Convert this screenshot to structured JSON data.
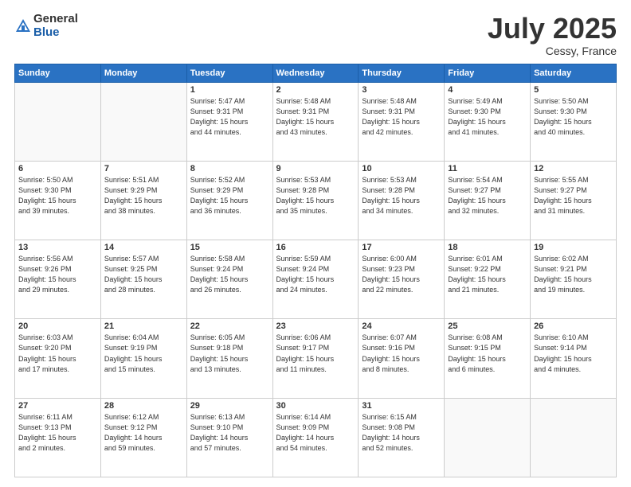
{
  "logo": {
    "general": "General",
    "blue": "Blue"
  },
  "title": "July 2025",
  "location": "Cessy, France",
  "days_header": [
    "Sunday",
    "Monday",
    "Tuesday",
    "Wednesday",
    "Thursday",
    "Friday",
    "Saturday"
  ],
  "weeks": [
    [
      {
        "day": "",
        "text": ""
      },
      {
        "day": "",
        "text": ""
      },
      {
        "day": "1",
        "text": "Sunrise: 5:47 AM\nSunset: 9:31 PM\nDaylight: 15 hours\nand 44 minutes."
      },
      {
        "day": "2",
        "text": "Sunrise: 5:48 AM\nSunset: 9:31 PM\nDaylight: 15 hours\nand 43 minutes."
      },
      {
        "day": "3",
        "text": "Sunrise: 5:48 AM\nSunset: 9:31 PM\nDaylight: 15 hours\nand 42 minutes."
      },
      {
        "day": "4",
        "text": "Sunrise: 5:49 AM\nSunset: 9:30 PM\nDaylight: 15 hours\nand 41 minutes."
      },
      {
        "day": "5",
        "text": "Sunrise: 5:50 AM\nSunset: 9:30 PM\nDaylight: 15 hours\nand 40 minutes."
      }
    ],
    [
      {
        "day": "6",
        "text": "Sunrise: 5:50 AM\nSunset: 9:30 PM\nDaylight: 15 hours\nand 39 minutes."
      },
      {
        "day": "7",
        "text": "Sunrise: 5:51 AM\nSunset: 9:29 PM\nDaylight: 15 hours\nand 38 minutes."
      },
      {
        "day": "8",
        "text": "Sunrise: 5:52 AM\nSunset: 9:29 PM\nDaylight: 15 hours\nand 36 minutes."
      },
      {
        "day": "9",
        "text": "Sunrise: 5:53 AM\nSunset: 9:28 PM\nDaylight: 15 hours\nand 35 minutes."
      },
      {
        "day": "10",
        "text": "Sunrise: 5:53 AM\nSunset: 9:28 PM\nDaylight: 15 hours\nand 34 minutes."
      },
      {
        "day": "11",
        "text": "Sunrise: 5:54 AM\nSunset: 9:27 PM\nDaylight: 15 hours\nand 32 minutes."
      },
      {
        "day": "12",
        "text": "Sunrise: 5:55 AM\nSunset: 9:27 PM\nDaylight: 15 hours\nand 31 minutes."
      }
    ],
    [
      {
        "day": "13",
        "text": "Sunrise: 5:56 AM\nSunset: 9:26 PM\nDaylight: 15 hours\nand 29 minutes."
      },
      {
        "day": "14",
        "text": "Sunrise: 5:57 AM\nSunset: 9:25 PM\nDaylight: 15 hours\nand 28 minutes."
      },
      {
        "day": "15",
        "text": "Sunrise: 5:58 AM\nSunset: 9:24 PM\nDaylight: 15 hours\nand 26 minutes."
      },
      {
        "day": "16",
        "text": "Sunrise: 5:59 AM\nSunset: 9:24 PM\nDaylight: 15 hours\nand 24 minutes."
      },
      {
        "day": "17",
        "text": "Sunrise: 6:00 AM\nSunset: 9:23 PM\nDaylight: 15 hours\nand 22 minutes."
      },
      {
        "day": "18",
        "text": "Sunrise: 6:01 AM\nSunset: 9:22 PM\nDaylight: 15 hours\nand 21 minutes."
      },
      {
        "day": "19",
        "text": "Sunrise: 6:02 AM\nSunset: 9:21 PM\nDaylight: 15 hours\nand 19 minutes."
      }
    ],
    [
      {
        "day": "20",
        "text": "Sunrise: 6:03 AM\nSunset: 9:20 PM\nDaylight: 15 hours\nand 17 minutes."
      },
      {
        "day": "21",
        "text": "Sunrise: 6:04 AM\nSunset: 9:19 PM\nDaylight: 15 hours\nand 15 minutes."
      },
      {
        "day": "22",
        "text": "Sunrise: 6:05 AM\nSunset: 9:18 PM\nDaylight: 15 hours\nand 13 minutes."
      },
      {
        "day": "23",
        "text": "Sunrise: 6:06 AM\nSunset: 9:17 PM\nDaylight: 15 hours\nand 11 minutes."
      },
      {
        "day": "24",
        "text": "Sunrise: 6:07 AM\nSunset: 9:16 PM\nDaylight: 15 hours\nand 8 minutes."
      },
      {
        "day": "25",
        "text": "Sunrise: 6:08 AM\nSunset: 9:15 PM\nDaylight: 15 hours\nand 6 minutes."
      },
      {
        "day": "26",
        "text": "Sunrise: 6:10 AM\nSunset: 9:14 PM\nDaylight: 15 hours\nand 4 minutes."
      }
    ],
    [
      {
        "day": "27",
        "text": "Sunrise: 6:11 AM\nSunset: 9:13 PM\nDaylight: 15 hours\nand 2 minutes."
      },
      {
        "day": "28",
        "text": "Sunrise: 6:12 AM\nSunset: 9:12 PM\nDaylight: 14 hours\nand 59 minutes."
      },
      {
        "day": "29",
        "text": "Sunrise: 6:13 AM\nSunset: 9:10 PM\nDaylight: 14 hours\nand 57 minutes."
      },
      {
        "day": "30",
        "text": "Sunrise: 6:14 AM\nSunset: 9:09 PM\nDaylight: 14 hours\nand 54 minutes."
      },
      {
        "day": "31",
        "text": "Sunrise: 6:15 AM\nSunset: 9:08 PM\nDaylight: 14 hours\nand 52 minutes."
      },
      {
        "day": "",
        "text": ""
      },
      {
        "day": "",
        "text": ""
      }
    ]
  ]
}
